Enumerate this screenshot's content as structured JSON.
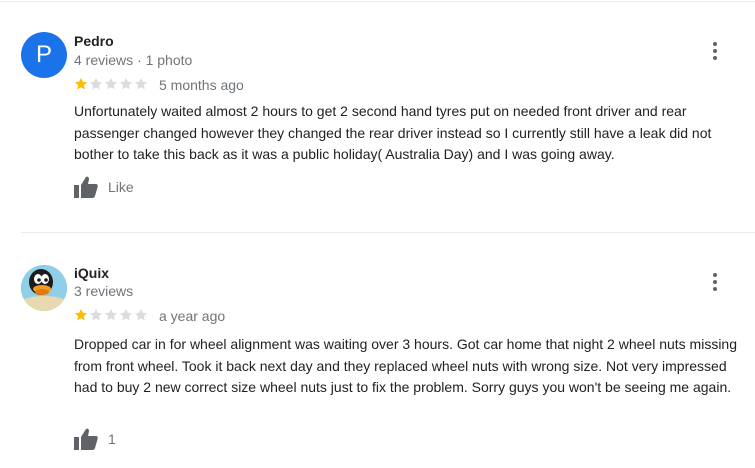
{
  "colors": {
    "star_filled": "#fbbc04",
    "star_empty": "#dadce0",
    "avatar_pedro": "#1a73e8"
  },
  "reviews": [
    {
      "avatar_letter": "P",
      "name": "Pedro",
      "meta": "4 reviews · 1 photo",
      "rating": 1,
      "rating_max": 5,
      "time": "5 months ago",
      "text": "Unfortunately waited almost 2 hours to get 2 second hand tyres put on needed front driver and rear passenger changed however they changed the rear driver instead so I currently still have a leak did not bother to take this back as it was a public holiday( Australia Day) and I was going away.",
      "like_label": "Like",
      "more_icon": "more-vert-icon"
    },
    {
      "avatar_icon": "duck-avatar-icon",
      "name": "iQuix",
      "meta": "3 reviews",
      "rating": 1,
      "rating_max": 5,
      "time": "a year ago",
      "text": "Dropped car in for wheel alignment was waiting over 3 hours.  Got car home that night 2 wheel nuts missing from front wheel.  Took it back next day and they replaced wheel nuts with wrong size.  Not very impressed had to buy 2 new correct size wheel nuts just to fix the problem. Sorry guys you won't be seeing me again.",
      "like_label": "1",
      "more_icon": "more-vert-icon"
    }
  ]
}
